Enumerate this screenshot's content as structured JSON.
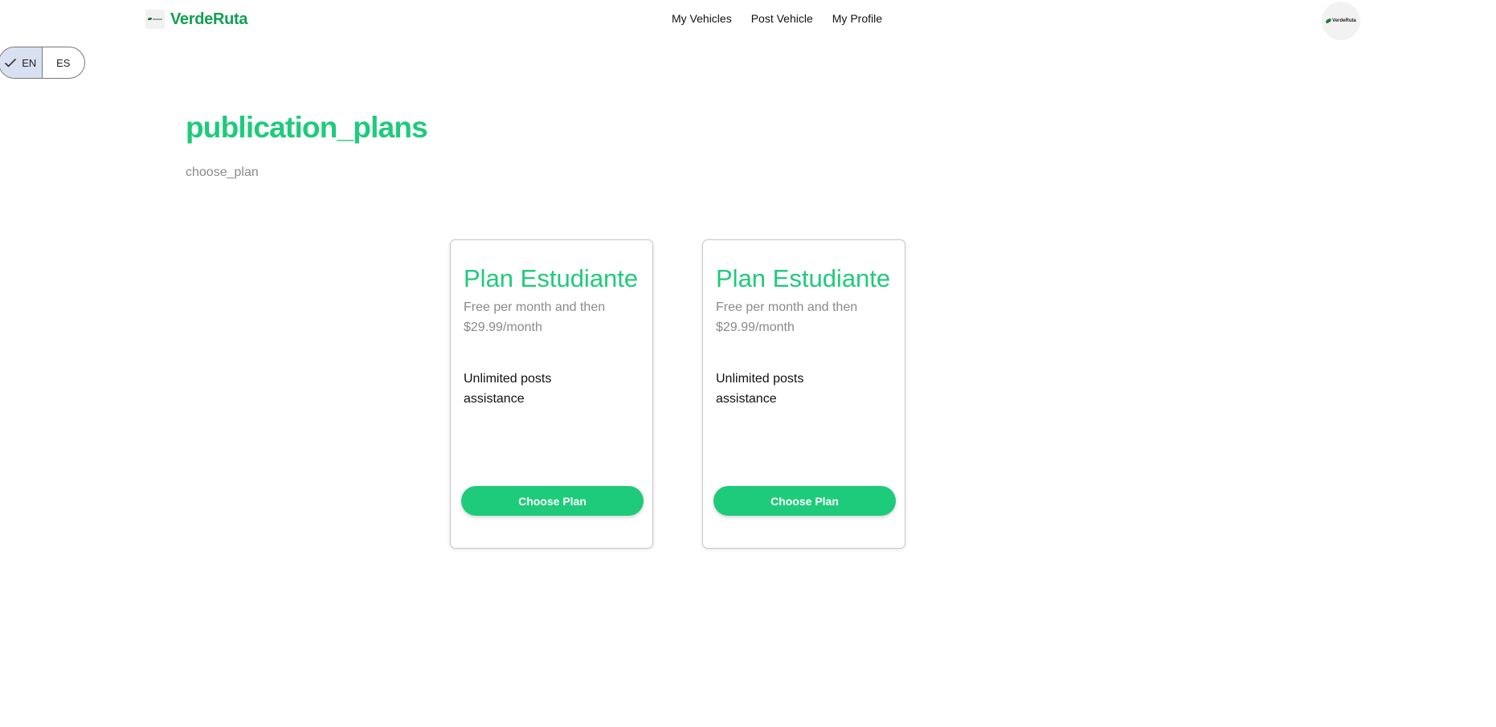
{
  "navbar": {
    "brand": "VerdeRuta",
    "links": [
      "My Vehicles",
      "Post Vehicle",
      "My Profile"
    ],
    "avatar_text": "VerdeRuta"
  },
  "language": {
    "options": [
      "EN",
      "ES"
    ],
    "selected": "EN"
  },
  "page": {
    "title": "publication_plans",
    "subtitle": "choose_plan"
  },
  "plans": [
    {
      "name": "Plan Estudiante",
      "price": "Free per month and then $29.99/month",
      "features": [
        "Unlimited posts",
        "assistance"
      ],
      "button": "Choose Plan"
    },
    {
      "name": "Plan Estudiante",
      "price": "Free per month and then $29.99/month",
      "features": [
        "Unlimited posts",
        "assistance"
      ],
      "button": "Choose Plan"
    }
  ],
  "colors": {
    "accent": "#1ecb7b",
    "brand": "#12a052",
    "muted": "#8a8a8a",
    "lang_active_bg": "#d9e0f1"
  }
}
